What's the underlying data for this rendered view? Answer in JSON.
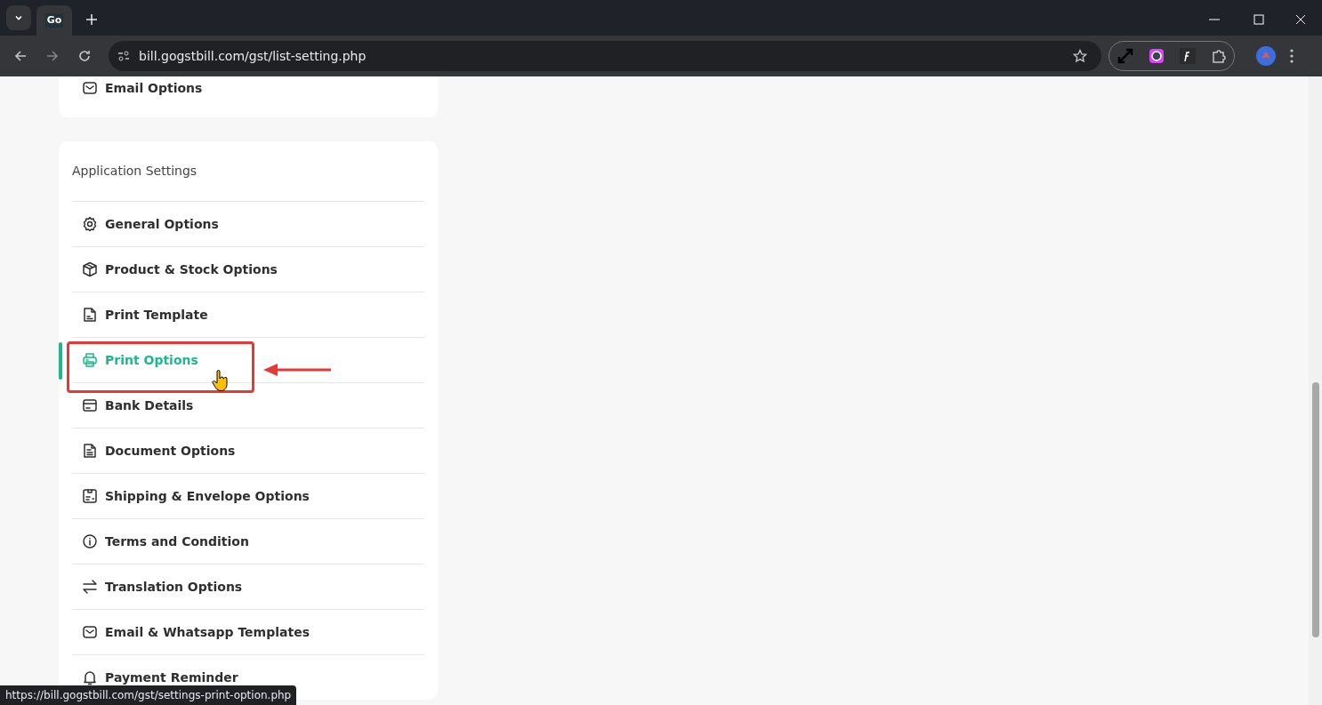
{
  "browser": {
    "tab_favicon": "Go",
    "url": "bill.gogstbill.com/gst/list-setting.php",
    "status_url": "https://bill.gogstbill.com/gst/settings-print-option.php"
  },
  "top_card": {
    "items": [
      {
        "label": "Email Options",
        "kind": "mail",
        "selected": false
      }
    ]
  },
  "settings_card": {
    "title": "Application Settings",
    "items": [
      {
        "label": "General Options",
        "kind": "gear",
        "selected": false
      },
      {
        "label": "Product & Stock Options",
        "kind": "box",
        "selected": false
      },
      {
        "label": "Print Template",
        "kind": "template",
        "selected": false
      },
      {
        "label": "Print Options",
        "kind": "printer",
        "selected": true
      },
      {
        "label": "Bank Details",
        "kind": "card",
        "selected": false
      },
      {
        "label": "Document Options",
        "kind": "doc",
        "selected": false
      },
      {
        "label": "Shipping & Envelope Options",
        "kind": "ship",
        "selected": false
      },
      {
        "label": "Terms and Condition",
        "kind": "info",
        "selected": false
      },
      {
        "label": "Translation Options",
        "kind": "swap",
        "selected": false
      },
      {
        "label": "Email & Whatsapp Templates",
        "kind": "mail",
        "selected": false
      },
      {
        "label": "Payment Reminder",
        "kind": "bell",
        "selected": false
      }
    ]
  }
}
